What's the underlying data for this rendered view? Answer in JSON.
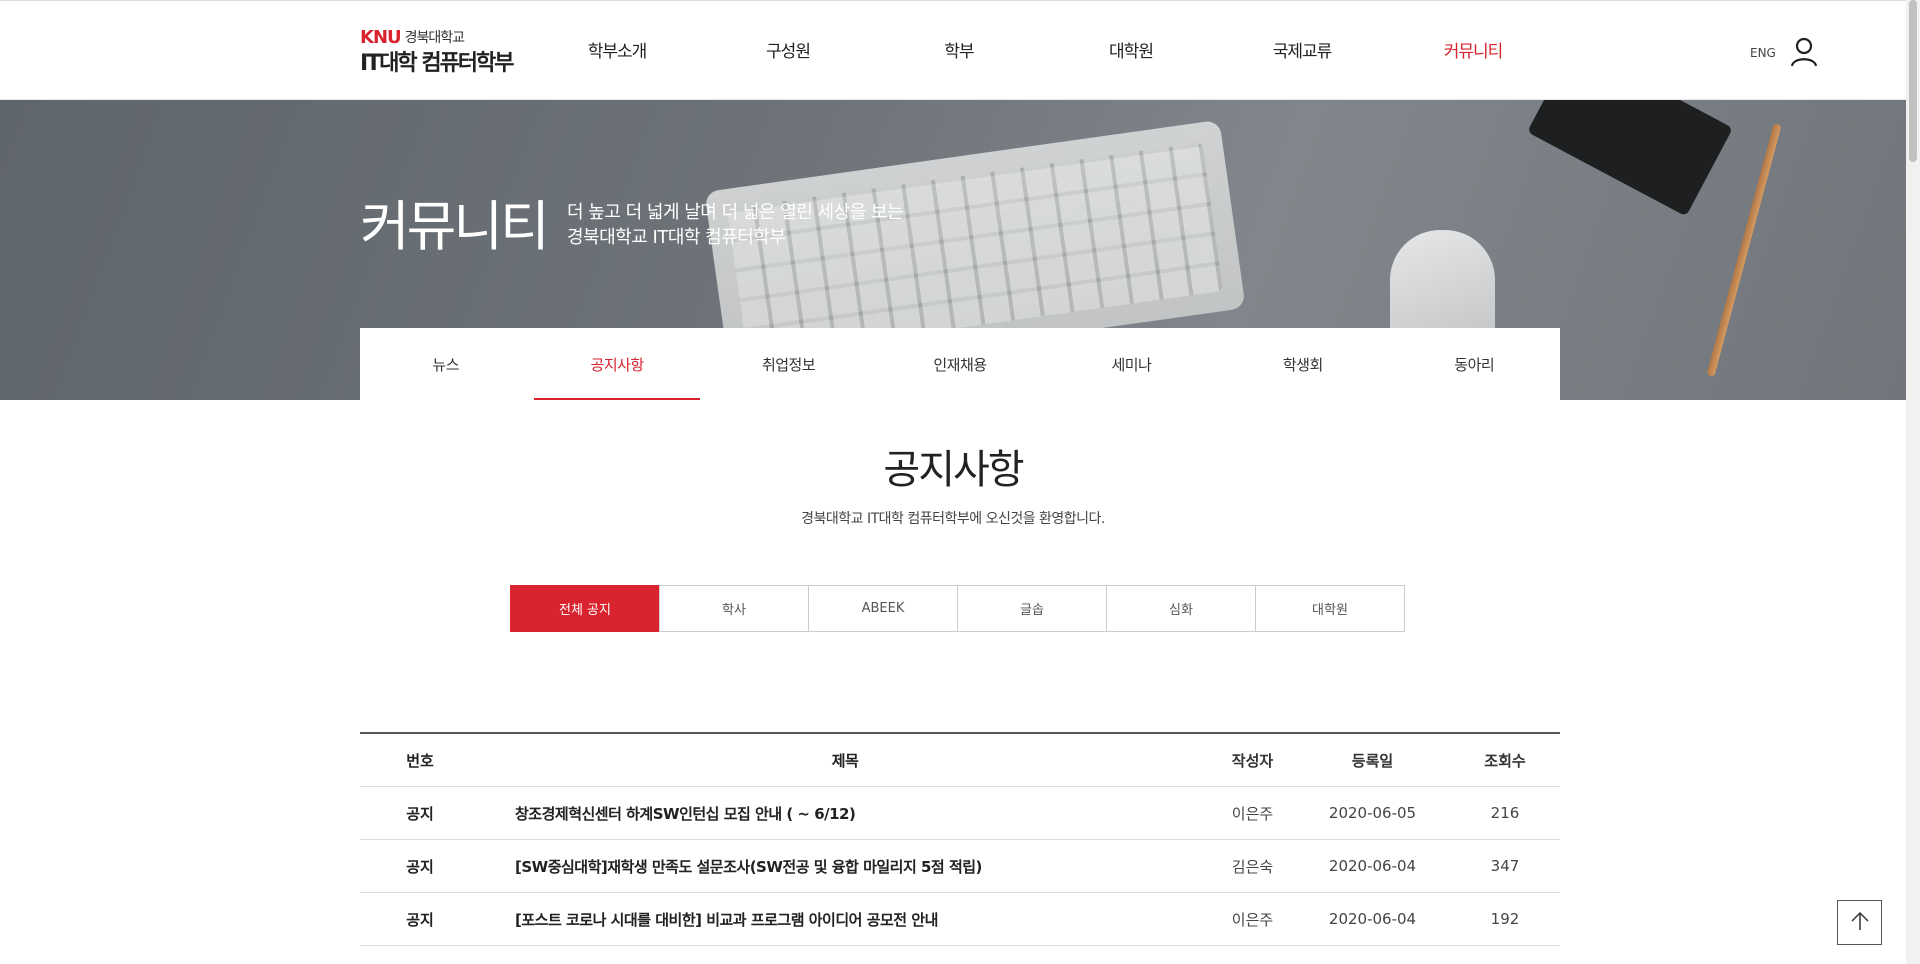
{
  "header": {
    "logo_knu": "KNU",
    "logo_univ": "경북대학교",
    "logo_dept": "IT대학 컴퓨터학부",
    "nav": [
      "학부소개",
      "구성원",
      "학부",
      "대학원",
      "국제교류",
      "커뮤니티"
    ],
    "active_nav": "커뮤니티",
    "lang": "ENG",
    "user_icon": "user-icon"
  },
  "hero": {
    "title": "커뮤니티",
    "slogan_line1": "더 높고 더 넓게 날며 더 넓은 열린 세상을 보는",
    "slogan_line2": "경북대학교 IT대학 컴퓨터학부"
  },
  "subtabs": [
    "뉴스",
    "공지사항",
    "취업정보",
    "인재채용",
    "세미나",
    "학생회",
    "동아리"
  ],
  "active_subtab": "공지사항",
  "page": {
    "title": "공지사항",
    "subtitle": "경북대학교 IT대학 컴퓨터학부에 오신것을 환영합니다."
  },
  "categories": [
    "전체 공지",
    "학사",
    "ABEEK",
    "글솝",
    "심화",
    "대학원"
  ],
  "active_category": "전체 공지",
  "table": {
    "headers": {
      "num": "번호",
      "title": "제목",
      "writer": "작성자",
      "date": "등록일",
      "views": "조회수"
    },
    "rows": [
      {
        "num": "공지",
        "title": "창조경제혁신센터 하계SW인턴십 모집 안내 ( ~ 6/12)",
        "writer": "이은주",
        "date": "2020-06-05",
        "views": "216"
      },
      {
        "num": "공지",
        "title": "[SW중심대학]재학생 만족도 설문조사(SW전공 및 융합 마일리지 5점 적립)",
        "writer": "김은숙",
        "date": "2020-06-04",
        "views": "347"
      },
      {
        "num": "공지",
        "title": "[포스트 코로나 시대를 대비한] 비교과 프로그램 아이디어 공모전 안내",
        "writer": "이은주",
        "date": "2020-06-04",
        "views": "192"
      }
    ]
  },
  "colors": {
    "accent": "#d9232e",
    "text": "#222222",
    "border": "#dddddd"
  },
  "icons": {
    "top": "arrow-up-icon",
    "user": "user-icon"
  }
}
